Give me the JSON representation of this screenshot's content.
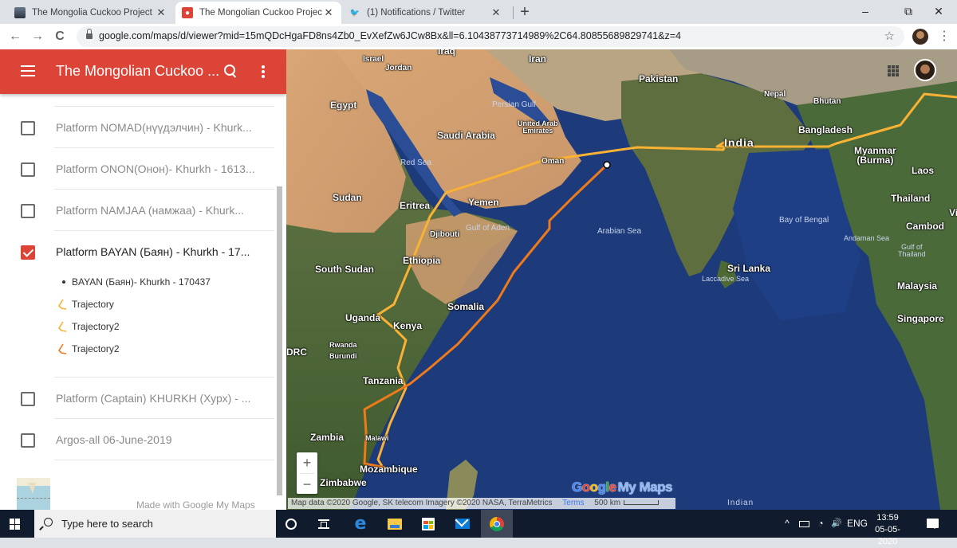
{
  "browser": {
    "tabs": [
      {
        "title": "The Mongolia Cuckoo Project – B",
        "favicon": "image-favicon",
        "active": false
      },
      {
        "title": "The Mongolian Cuckoo Project -",
        "favicon": "maps-pin-favicon",
        "active": true
      },
      {
        "title": "(1) Notifications / Twitter",
        "favicon": "twitter-bird-favicon",
        "active": false
      }
    ],
    "new_tab_label": "+",
    "window_controls": {
      "minimize": "–",
      "maximize": "⧉",
      "close": "✕"
    },
    "nav": {
      "back": "←",
      "forward": "→",
      "reload": "C"
    },
    "url": "google.com/maps/d/viewer?mid=15mQDcHgaFD8ns4Zb0_EvXefZw6JCw8Bx&ll=6.10438773714989%2C64.80855689829741&z=4",
    "bookmark_icon": "☆",
    "menu_icon": "⋮"
  },
  "panel": {
    "title": "The Mongolian Cuckoo ...",
    "layers": [
      {
        "name": "Platform NOMAD(нүүдэлчин) - Khurk...",
        "checked": false
      },
      {
        "name": "Platform ONON(Онон)- Khurkh - 1613...",
        "checked": false
      },
      {
        "name": "Platform NAMJAA (намжаа) - Khurk...",
        "checked": false
      },
      {
        "name": "Platform BAYAN (Баян) - Khurkh - 17...",
        "checked": true,
        "items": [
          {
            "type": "point",
            "label": "BAYAN (Баян)- Khurkh - 170437"
          },
          {
            "type": "line",
            "label": "Trajectory"
          },
          {
            "type": "line",
            "label": "Trajectory2"
          },
          {
            "type": "line",
            "label": "Trajectory2"
          }
        ]
      },
      {
        "name": "Platform (Captain) KHURKH (Хурх) - ...",
        "checked": false
      },
      {
        "name": "Argos-all 06-June-2019",
        "checked": false
      }
    ],
    "footer": "Made with Google My Maps"
  },
  "map": {
    "labels": {
      "israel": "Israel",
      "jordan": "Jordan",
      "iraq": "Iraq",
      "iran": "Iran",
      "pakistan": "Pakistan",
      "egypt": "Egypt",
      "persian_gulf": "Persian Gulf",
      "uae": "United Arab\nEmirates",
      "saudi": "Saudi Arabia",
      "nepal": "Nepal",
      "bhutan": "Bhutan",
      "bangladesh": "Bangladesh",
      "india": "India",
      "myanmar": "Myanmar\n(Burma)",
      "laos": "Laos",
      "red_sea": "Red Sea",
      "oman": "Oman",
      "sudan": "Sudan",
      "eritrea": "Eritrea",
      "yemen": "Yemen",
      "thailand": "Thailand",
      "bay_of_bengal": "Bay of Bengal",
      "gulf_of_aden": "Gulf of Aden",
      "djibouti": "Djibouti",
      "arabian_sea": "Arabian Sea",
      "cambodia": "Cambod",
      "vietnam": "Vi",
      "andaman_sea": "Andaman Sea",
      "gulf_of_thailand": "Gulf of\nThailand",
      "ethiopia": "Ethiopia",
      "south_sudan": "South Sudan",
      "sri_lanka": "Sri Lanka",
      "laccadive_sea": "Laccadive Sea",
      "malaysia": "Malaysia",
      "somalia": "Somalia",
      "uganda": "Uganda",
      "kenya": "Kenya",
      "singapore": "Singapore",
      "rwanda": "Rwanda",
      "burundi": "Burundi",
      "drc": "DRC",
      "tanzania": "Tanzania",
      "zambia": "Zambia",
      "malawi": "Malawi",
      "mozambique": "Mozambique",
      "zimbabwe": "Zimbabwe",
      "indian": "Indian"
    },
    "zoom_in": "+",
    "zoom_out": "−",
    "logo": {
      "google": [
        "G",
        "o",
        "o",
        "g",
        "l",
        "e"
      ],
      "rest": "My Maps"
    },
    "attribution": "Map data ©2020 Google, SK telecom Imagery ©2020 NASA, TerraMetrics",
    "terms": "Terms",
    "scale": "500 km",
    "colors": {
      "trajectory_light": "#f9b233",
      "trajectory_dark": "#ef7a1a",
      "ocean": "#1d3a7a"
    }
  },
  "taskbar": {
    "search_placeholder": "Type here to search",
    "tray": {
      "chevron": "^",
      "lang": "ENG",
      "volume": "🔊"
    },
    "time": "13:59",
    "date": "05-05-2020"
  }
}
